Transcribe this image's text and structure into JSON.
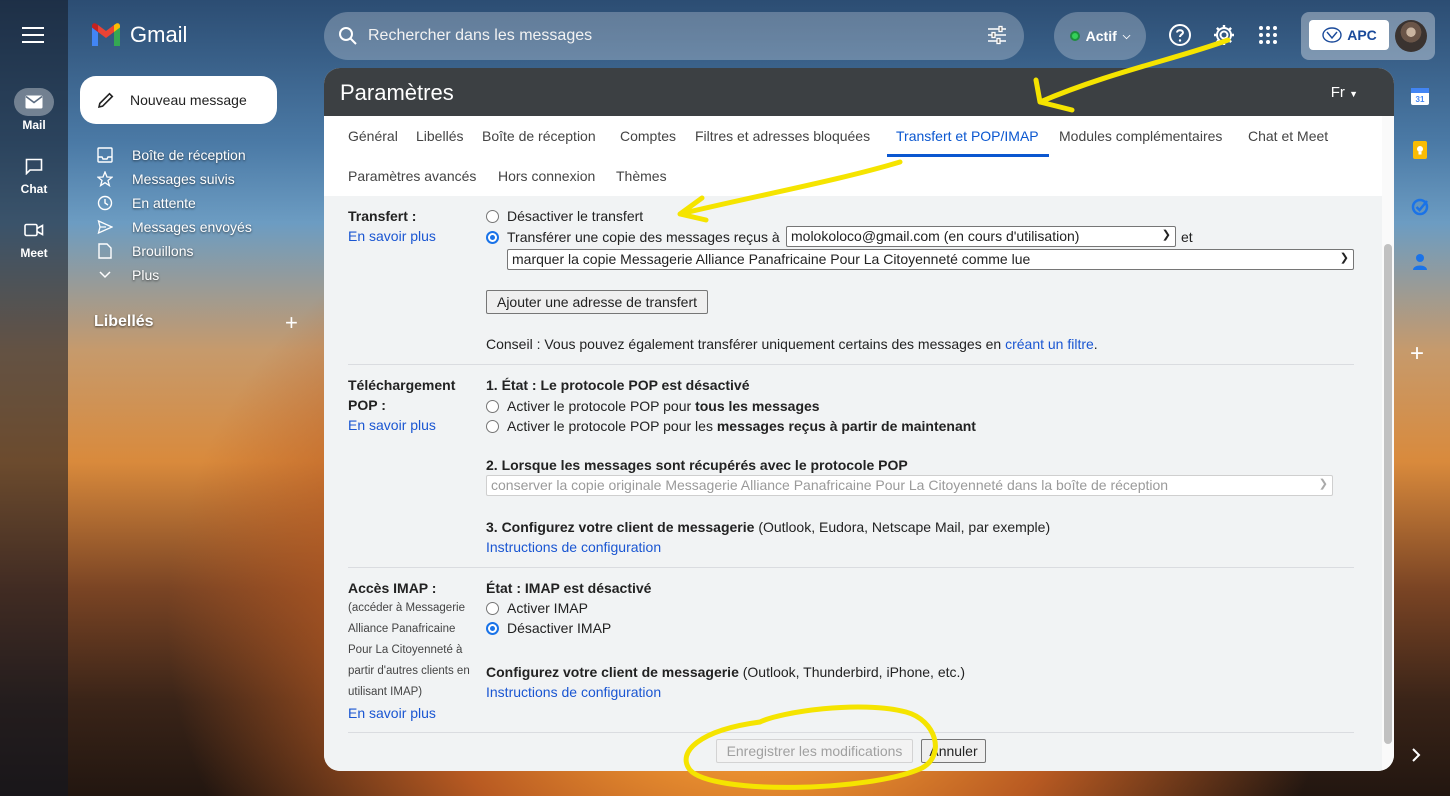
{
  "app": {
    "name": "Gmail"
  },
  "rail": {
    "mail": "Mail",
    "chat": "Chat",
    "meet": "Meet"
  },
  "compose": {
    "label": "Nouveau message"
  },
  "nav": [
    {
      "label": "Boîte de réception"
    },
    {
      "label": "Messages suivis"
    },
    {
      "label": "En attente"
    },
    {
      "label": "Messages envoyés"
    },
    {
      "label": "Brouillons"
    },
    {
      "label": "Plus"
    }
  ],
  "labels_heading": "Libellés",
  "search": {
    "placeholder": "Rechercher dans les messages"
  },
  "status": {
    "label": "Actif"
  },
  "account": {
    "org": "APC"
  },
  "colors": {
    "accent": "#0b57d0",
    "header": "#3c4043",
    "annotation": "#f5e400"
  },
  "settings": {
    "title": "Paramètres",
    "lang": "Fr",
    "tabs": [
      {
        "label": "Général"
      },
      {
        "label": "Libellés"
      },
      {
        "label": "Boîte de réception"
      },
      {
        "label": "Comptes"
      },
      {
        "label": "Filtres et adresses bloquées"
      },
      {
        "label": "Transfert et POP/IMAP",
        "active": true
      },
      {
        "label": "Modules complémentaires"
      },
      {
        "label": "Chat et Meet"
      },
      {
        "label": "Paramètres avancés"
      },
      {
        "label": "Hors connexion"
      },
      {
        "label": "Thèmes"
      }
    ],
    "learn_more": "En savoir plus",
    "forward": {
      "heading": "Transfert :",
      "opt_disable": "Désactiver le transfert",
      "opt_forward": "Transférer une copie des messages reçus à",
      "address": "molokoloco@gmail.com (en cours d'utilisation)",
      "and": "et",
      "action": "marquer la copie Messagerie Alliance Panafricaine Pour La Citoyenneté comme lue",
      "add_button": "Ajouter une adresse de transfert",
      "tip_prefix": "Conseil : Vous pouvez également transférer uniquement certains des messages en",
      "tip_link": "créant un filtre",
      "tip_suffix": "."
    },
    "pop": {
      "heading_1": "Téléchargement",
      "heading_2": "POP :",
      "state": "1. État : Le protocole POP est désactivé",
      "opt_all_prefix": "Activer le protocole POP pour",
      "opt_all_bold": "tous les messages",
      "opt_now_prefix": "Activer le protocole POP pour les",
      "opt_now_bold": "messages reçus à partir de maintenant",
      "step2": "2. Lorsque les messages sont récupérés avec le protocole POP",
      "step2_select": "conserver la copie originale Messagerie Alliance Panafricaine Pour La Citoyenneté dans la boîte de réception",
      "step3_bold": "3. Configurez votre client de messagerie",
      "step3_rest": "(Outlook, Eudora, Netscape Mail, par exemple)",
      "instructions": "Instructions de configuration"
    },
    "imap": {
      "heading": "Accès IMAP :",
      "note_lines": [
        "(accéder à Messagerie",
        "Alliance Panafricaine",
        "Pour La Citoyenneté à",
        "partir d'autres clients en",
        "utilisant IMAP)"
      ],
      "state": "État : IMAP est désactivé",
      "opt_enable": "Activer IMAP",
      "opt_disable": "Désactiver IMAP",
      "client_bold": "Configurez votre client de messagerie",
      "client_rest": "(Outlook, Thunderbird, iPhone, etc.)",
      "instructions": "Instructions de configuration"
    },
    "save_button": "Enregistrer les modifications",
    "cancel_button": "Annuler"
  }
}
